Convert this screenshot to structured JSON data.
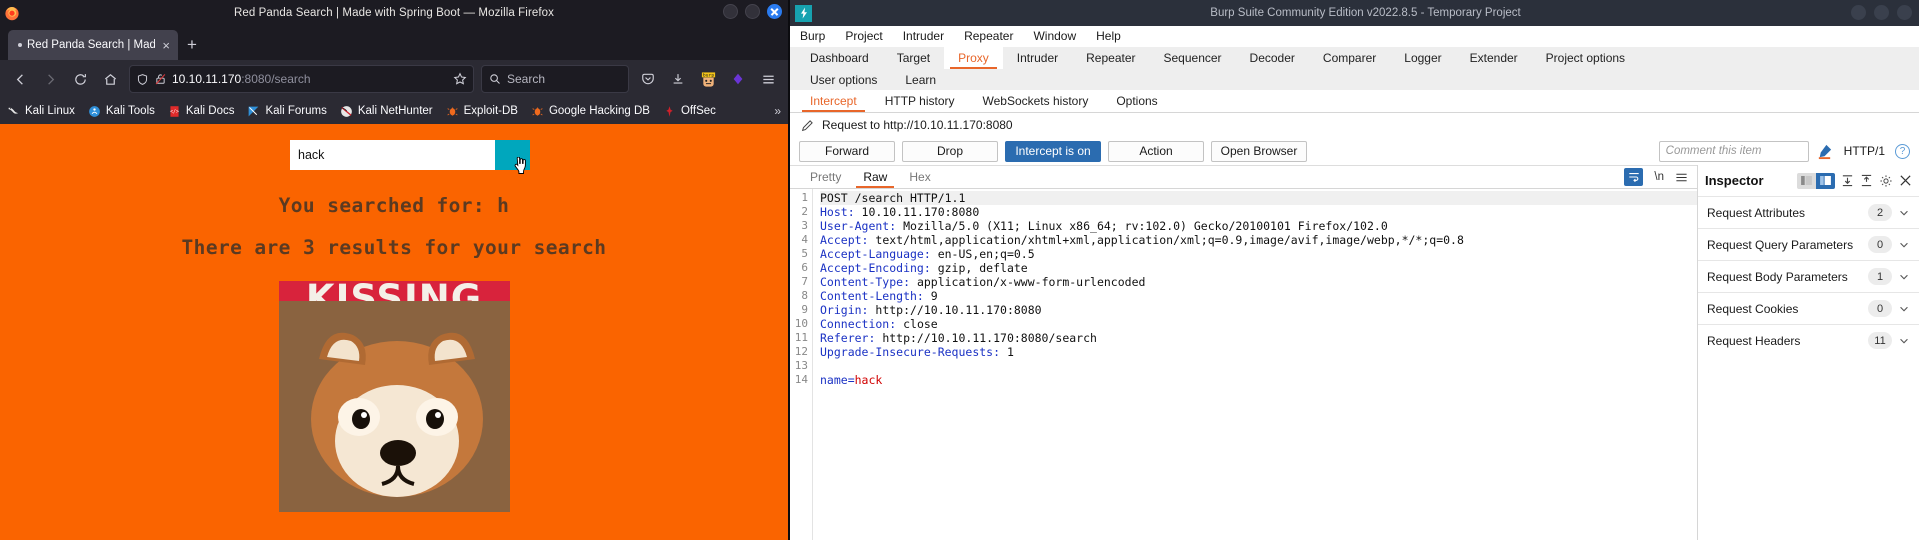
{
  "firefox": {
    "window_title": "Red Panda Search | Made with Spring Boot — Mozilla Firefox",
    "tab": {
      "label": "Red Panda Search | Made w",
      "close_label": "×"
    },
    "newtab_label": "+",
    "nav": {
      "back_icon": "back-arrow-icon",
      "forward_icon": "forward-arrow-icon",
      "reload_icon": "reload-icon",
      "home_icon": "home-icon"
    },
    "url": {
      "host": "10.10.11.170",
      "rest": ":8080/search"
    },
    "search": {
      "placeholder": "Search"
    },
    "bookmarks": [
      {
        "label": "Kali Linux",
        "icon": "kali-dragon-icon"
      },
      {
        "label": "Kali Tools",
        "icon": "kali-tools-icon"
      },
      {
        "label": "Kali Docs",
        "icon": "kali-docs-icon"
      },
      {
        "label": "Kali Forums",
        "icon": "kali-forums-icon"
      },
      {
        "label": "Kali NetHunter",
        "icon": "kali-nethunter-icon"
      },
      {
        "label": "Exploit-DB",
        "icon": "exploit-db-icon"
      },
      {
        "label": "Google Hacking DB",
        "icon": "google-hacking-db-icon"
      },
      {
        "label": "OffSec",
        "icon": "offsec-icon"
      }
    ],
    "bookmarks_overflow": "»",
    "page": {
      "search_value": "hack",
      "search_placeholder": "",
      "go_label": "",
      "line1": "You searched for: h",
      "line2": "There are 3 results for your search",
      "image_caption": "KISSING"
    }
  },
  "burp": {
    "window_title": "Burp Suite Community Edition v2022.8.5 - Temporary Project",
    "logo_glyph": "⚡",
    "menu": [
      "Burp",
      "Project",
      "Intruder",
      "Repeater",
      "Window",
      "Help"
    ],
    "main_tabs_row1": [
      "Dashboard",
      "Target",
      "Proxy",
      "Intruder",
      "Repeater",
      "Sequencer",
      "Decoder",
      "Comparer",
      "Logger",
      "Extender",
      "Project options"
    ],
    "main_tabs_row2": [
      "User options",
      "Learn"
    ],
    "active_main_tab": "Proxy",
    "sub_tabs": [
      "Intercept",
      "HTTP history",
      "WebSockets history",
      "Options"
    ],
    "active_sub_tab": "Intercept",
    "request_to": "Request to http://10.10.11.170:8080",
    "pencil_icon": "pencil-icon",
    "buttons": {
      "forward": "Forward",
      "drop": "Drop",
      "intercept": "Intercept is on",
      "action": "Action",
      "open_browser": "Open Browser"
    },
    "comment_placeholder": "Comment this item",
    "http_version": "HTTP/1",
    "help_label": "?",
    "editor_tabs": [
      "Pretty",
      "Raw",
      "Hex"
    ],
    "active_editor_tab": "Raw",
    "editor_tools": {
      "wrap_icon": "word-wrap-icon",
      "newline_label": "\\n",
      "menu_icon": "hamburger-icon"
    },
    "request": {
      "lines": [
        {
          "n": "1",
          "name": "",
          "value": "POST /search HTTP/1.1",
          "first": true
        },
        {
          "n": "2",
          "name": "Host",
          "value": " 10.10.11.170:8080"
        },
        {
          "n": "3",
          "name": "User-Agent",
          "value": " Mozilla/5.0 (X11; Linux x86_64; rv:102.0) Gecko/20100101 Firefox/102.0"
        },
        {
          "n": "4",
          "name": "Accept",
          "value": " text/html,application/xhtml+xml,application/xml;q=0.9,image/avif,image/webp,*/*;q=0.8"
        },
        {
          "n": "5",
          "name": "Accept-Language",
          "value": " en-US,en;q=0.5"
        },
        {
          "n": "6",
          "name": "Accept-Encoding",
          "value": " gzip, deflate"
        },
        {
          "n": "7",
          "name": "Content-Type",
          "value": " application/x-www-form-urlencoded"
        },
        {
          "n": "8",
          "name": "Content-Length",
          "value": " 9"
        },
        {
          "n": "9",
          "name": "Origin",
          "value": " http://10.10.11.170:8080"
        },
        {
          "n": "10",
          "name": "Connection",
          "value": " close"
        },
        {
          "n": "11",
          "name": "Referer",
          "value": " http://10.10.11.170:8080/search"
        },
        {
          "n": "12",
          "name": "Upgrade-Insecure-Requests",
          "value": " 1"
        },
        {
          "n": "13",
          "name": "",
          "value": ""
        },
        {
          "n": "14",
          "name": "name=",
          "value": "hack",
          "body": true
        }
      ]
    },
    "inspector": {
      "title": "Inspector",
      "close_label": "×",
      "rows": [
        {
          "label": "Request Attributes",
          "count": "2"
        },
        {
          "label": "Request Query Parameters",
          "count": "0"
        },
        {
          "label": "Request Body Parameters",
          "count": "1"
        },
        {
          "label": "Request Cookies",
          "count": "0"
        },
        {
          "label": "Request Headers",
          "count": "11"
        }
      ]
    }
  },
  "colors": {
    "page_orange": "#fa6400",
    "burp_accent": "#e8662a",
    "intercept_blue": "#2b6cb0",
    "teal_button": "#00a7bd"
  }
}
